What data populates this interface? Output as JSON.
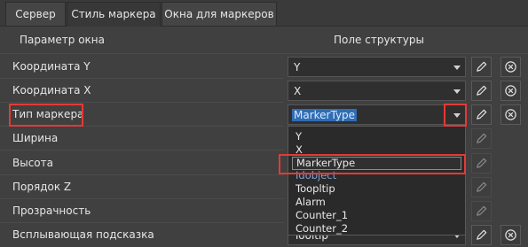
{
  "tabs": [
    {
      "label": "Сервер",
      "active": false
    },
    {
      "label": "Стиль маркера",
      "active": true
    },
    {
      "label": "Окна для маркеров",
      "active": false
    }
  ],
  "header": {
    "param_col": "Параметр окна",
    "field_col": "Поле структуры"
  },
  "rows": [
    {
      "label": "Координата Y",
      "value": "Y"
    },
    {
      "label": "Координата X",
      "value": "X"
    },
    {
      "label": "Тип маркера",
      "value": "MarkerType"
    },
    {
      "label": "Ширина",
      "value": ""
    },
    {
      "label": "Высота",
      "value": ""
    },
    {
      "label": "Порядок Z",
      "value": ""
    },
    {
      "label": "Прозрачность",
      "value": ""
    },
    {
      "label": "Всплывающая подсказка",
      "value": "Tooltip"
    }
  ],
  "dropdown": {
    "items": [
      "Y",
      "X",
      "MarkerType",
      "Idobject",
      "Toopltip",
      "Alarm",
      "Counter_1",
      "Counter_2"
    ],
    "selected": "MarkerType"
  },
  "colors": {
    "background": "#404040",
    "highlight": "#e53935",
    "selection": "#2f6db5"
  },
  "icons": {
    "edit": "pencil-icon",
    "clear": "clear-circle-icon",
    "open": "chevron-down-icon"
  }
}
